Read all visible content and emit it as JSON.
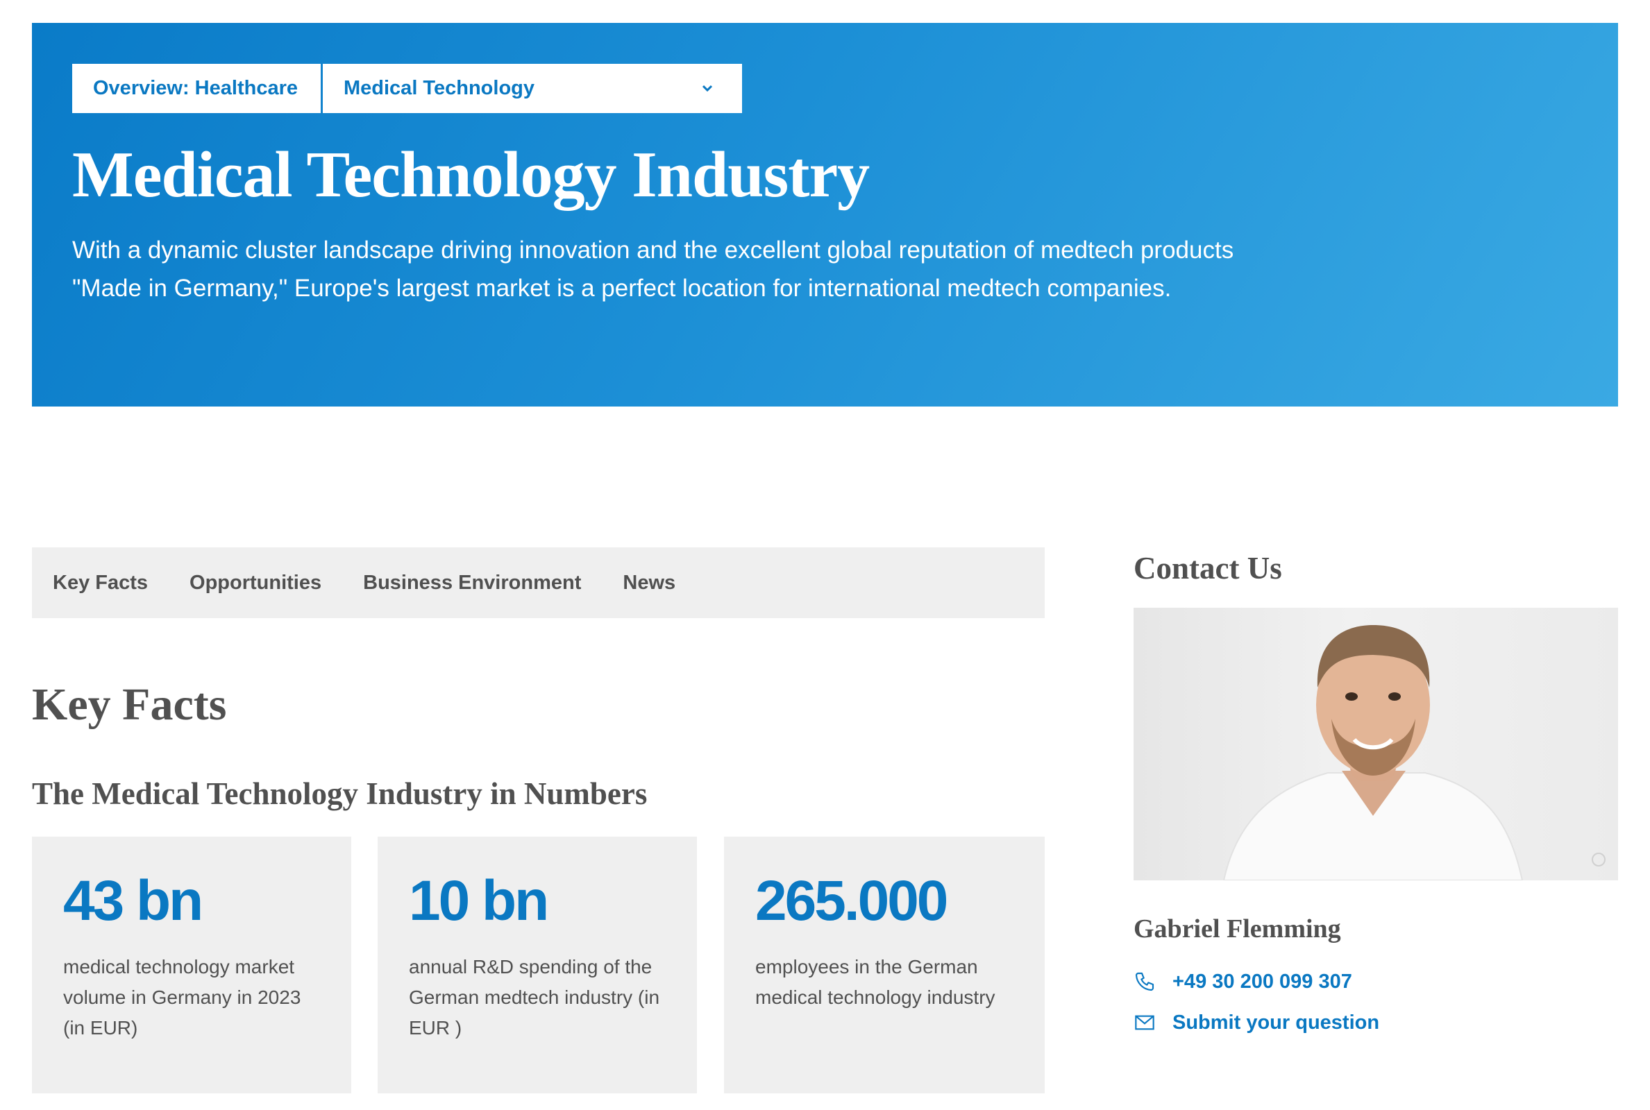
{
  "hero": {
    "breadcrumb_overview": "Overview: Healthcare",
    "breadcrumb_select": "Medical Technology",
    "title": "Medical Technology Industry",
    "description": "With a dynamic cluster landscape driving innovation and the excellent global reputation of medtech products \"Made in Germany,\" Europe's largest market is a perfect location for international medtech companies."
  },
  "subnav": {
    "items": [
      "Key Facts",
      "Opportunities",
      "Business Environment",
      "News"
    ]
  },
  "key_facts": {
    "heading": "Key Facts",
    "subheading": "The Medical Technology Industry in Numbers",
    "cards": [
      {
        "value": "43 bn",
        "label": "medical technology market volume in Germany in 2023 (in EUR)"
      },
      {
        "value": "10 bn",
        "label": "annual R&D spending of the German medtech industry (in EUR )"
      },
      {
        "value": "265.000",
        "label": "employees in the German medical technology industry"
      }
    ]
  },
  "contact": {
    "title": "Contact Us",
    "name": "Gabriel Flemming",
    "phone": "+49 30 200 099 307",
    "question_link": "Submit your question"
  },
  "icons": {
    "dropdown": "chevron-down-icon",
    "phone": "phone-icon",
    "mail": "mail-icon"
  },
  "colors": {
    "accent": "#0a78c2",
    "hero_start": "#0a7bc8",
    "hero_end": "#3aa9e3",
    "panel": "#efefef",
    "text": "#505050"
  }
}
